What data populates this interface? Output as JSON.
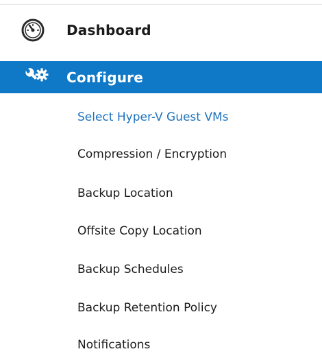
{
  "nav": {
    "dashboard": {
      "label": "Dashboard",
      "icon": "gauge-icon"
    },
    "configure": {
      "label": "Configure",
      "icon": "wrench-gear-icon",
      "selected": true
    }
  },
  "submenu": {
    "items": [
      {
        "label": "Select Hyper-V Guest VMs",
        "active": true
      },
      {
        "label": "Compression / Encryption"
      },
      {
        "label": "Backup Location"
      },
      {
        "label": "Offsite Copy Location"
      },
      {
        "label": "Backup Schedules"
      },
      {
        "label": "Backup Retention Policy"
      },
      {
        "label": "Notifications"
      }
    ]
  },
  "colors": {
    "selected_bg": "#0f78c7",
    "active_link": "#1e73be",
    "text": "#1a1a1a"
  }
}
